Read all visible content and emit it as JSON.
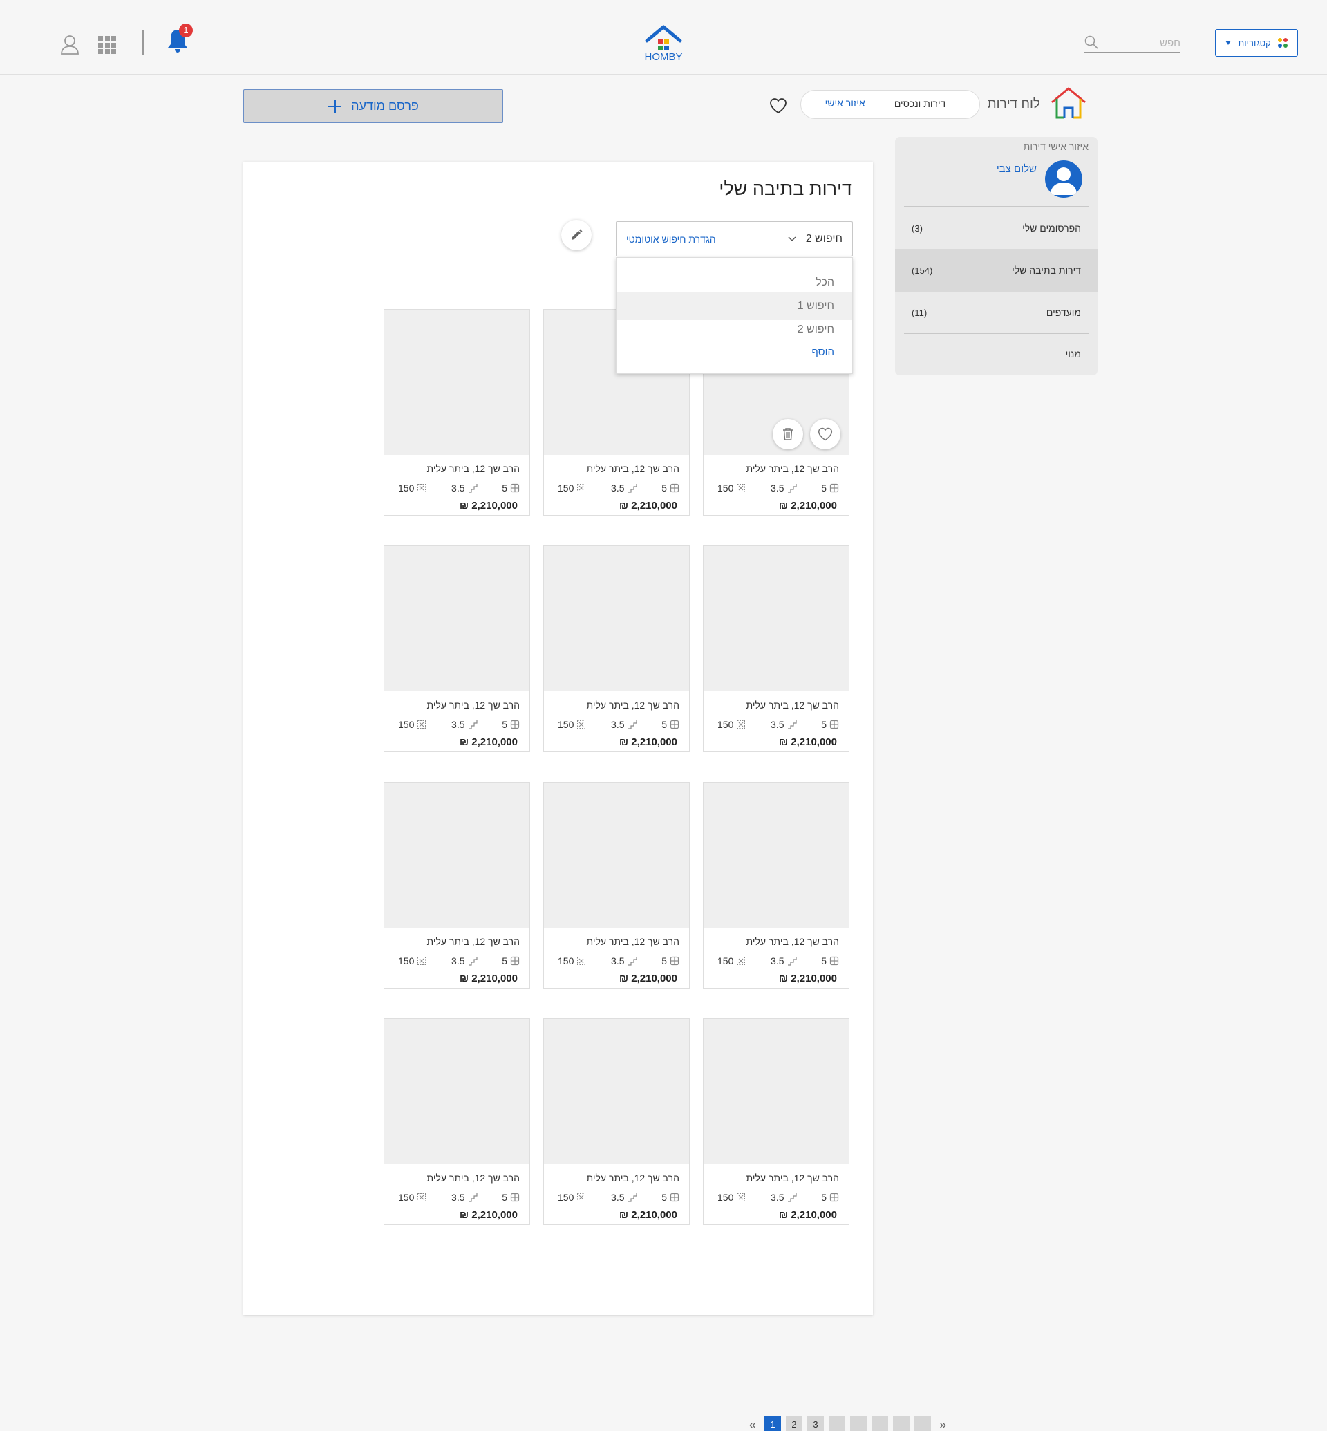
{
  "header": {
    "logo_text": "HOMBY",
    "notification_count": "1",
    "search_placeholder": "חפש",
    "categories_label": "קטגוריות",
    "brand_color": "#1a66c8"
  },
  "subheader": {
    "board_title": "לוח דירות",
    "tabs": [
      {
        "label": "דירות ונכסים",
        "active": false
      },
      {
        "label": "איזור אישי",
        "active": true
      }
    ],
    "publish_label": "פרסם מודעה"
  },
  "sidebar": {
    "title": "איזור אישי דירות",
    "user_name": "שלום צבי",
    "items": [
      {
        "label": "הפרסומים שלי",
        "count": "(3)"
      },
      {
        "label": "דירות בתיבה שלי",
        "count": "(154)",
        "active": true
      },
      {
        "label": "מועדפים",
        "count": "(11)"
      },
      {
        "label": "מנוי",
        "count": ""
      }
    ]
  },
  "main": {
    "title": "דירות בתיבה שלי",
    "selected_search": "חיפוש 2",
    "auto_search_link": "הגדרת חיפוש אוטומטי",
    "dropdown": {
      "options": [
        "הכל",
        "חיפוש 1",
        "חיפוש 2"
      ],
      "add_label": "הוסף"
    }
  },
  "cards": [
    {
      "address": "הרב שך 12, ביתר עלית",
      "rooms": "5",
      "floor": "3.5",
      "size": "150",
      "price": "2,210,000 ₪"
    },
    {
      "address": "הרב שך 12, ביתר עלית",
      "rooms": "5",
      "floor": "3.5",
      "size": "150",
      "price": "2,210,000 ₪"
    },
    {
      "address": "הרב שך 12, ביתר עלית",
      "rooms": "5",
      "floor": "3.5",
      "size": "150",
      "price": "2,210,000 ₪"
    },
    {
      "address": "הרב שך 12, ביתר עלית",
      "rooms": "5",
      "floor": "3.5",
      "size": "150",
      "price": "2,210,000 ₪"
    },
    {
      "address": "הרב שך 12, ביתר עלית",
      "rooms": "5",
      "floor": "3.5",
      "size": "150",
      "price": "2,210,000 ₪"
    },
    {
      "address": "הרב שך 12, ביתר עלית",
      "rooms": "5",
      "floor": "3.5",
      "size": "150",
      "price": "2,210,000 ₪"
    },
    {
      "address": "הרב שך 12, ביתר עלית",
      "rooms": "5",
      "floor": "3.5",
      "size": "150",
      "price": "2,210,000 ₪"
    },
    {
      "address": "הרב שך 12, ביתר עלית",
      "rooms": "5",
      "floor": "3.5",
      "size": "150",
      "price": "2,210,000 ₪"
    },
    {
      "address": "הרב שך 12, ביתר עלית",
      "rooms": "5",
      "floor": "3.5",
      "size": "150",
      "price": "2,210,000 ₪"
    },
    {
      "address": "הרב שך 12, ביתר עלית",
      "rooms": "5",
      "floor": "3.5",
      "size": "150",
      "price": "2,210,000 ₪"
    },
    {
      "address": "הרב שך 12, ביתר עלית",
      "rooms": "5",
      "floor": "3.5",
      "size": "150",
      "price": "2,210,000 ₪"
    },
    {
      "address": "הרב שך 12, ביתר עלית",
      "rooms": "5",
      "floor": "3.5",
      "size": "150",
      "price": "2,210,000 ₪"
    }
  ],
  "pagination": {
    "pages": [
      "1",
      "2",
      "3",
      "",
      "",
      "",
      "",
      ""
    ],
    "current": "1"
  }
}
